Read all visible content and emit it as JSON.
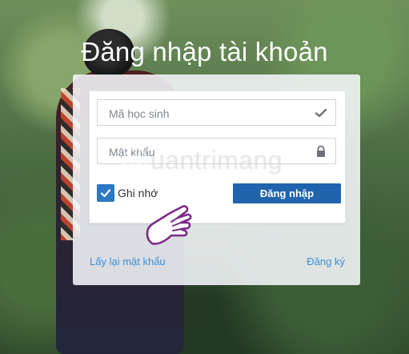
{
  "page": {
    "title": "Đăng nhập tài khoản"
  },
  "form": {
    "student_id": {
      "placeholder": "Mã học sinh",
      "value": "",
      "icon": "check-icon"
    },
    "password": {
      "placeholder": "Mật khẩu",
      "value": "",
      "icon": "lock-icon"
    },
    "remember": {
      "label": "Ghi nhớ",
      "checked": true
    },
    "submit_label": "Đăng nhập"
  },
  "links": {
    "forgot_password": "Lấy lại mật khẩu",
    "register": "Đăng ký"
  },
  "watermark": {
    "text": "uantrimang"
  },
  "colors": {
    "primary_button": "#1f64ad",
    "checkbox": "#2b79c2",
    "link": "#3d8fd6"
  }
}
